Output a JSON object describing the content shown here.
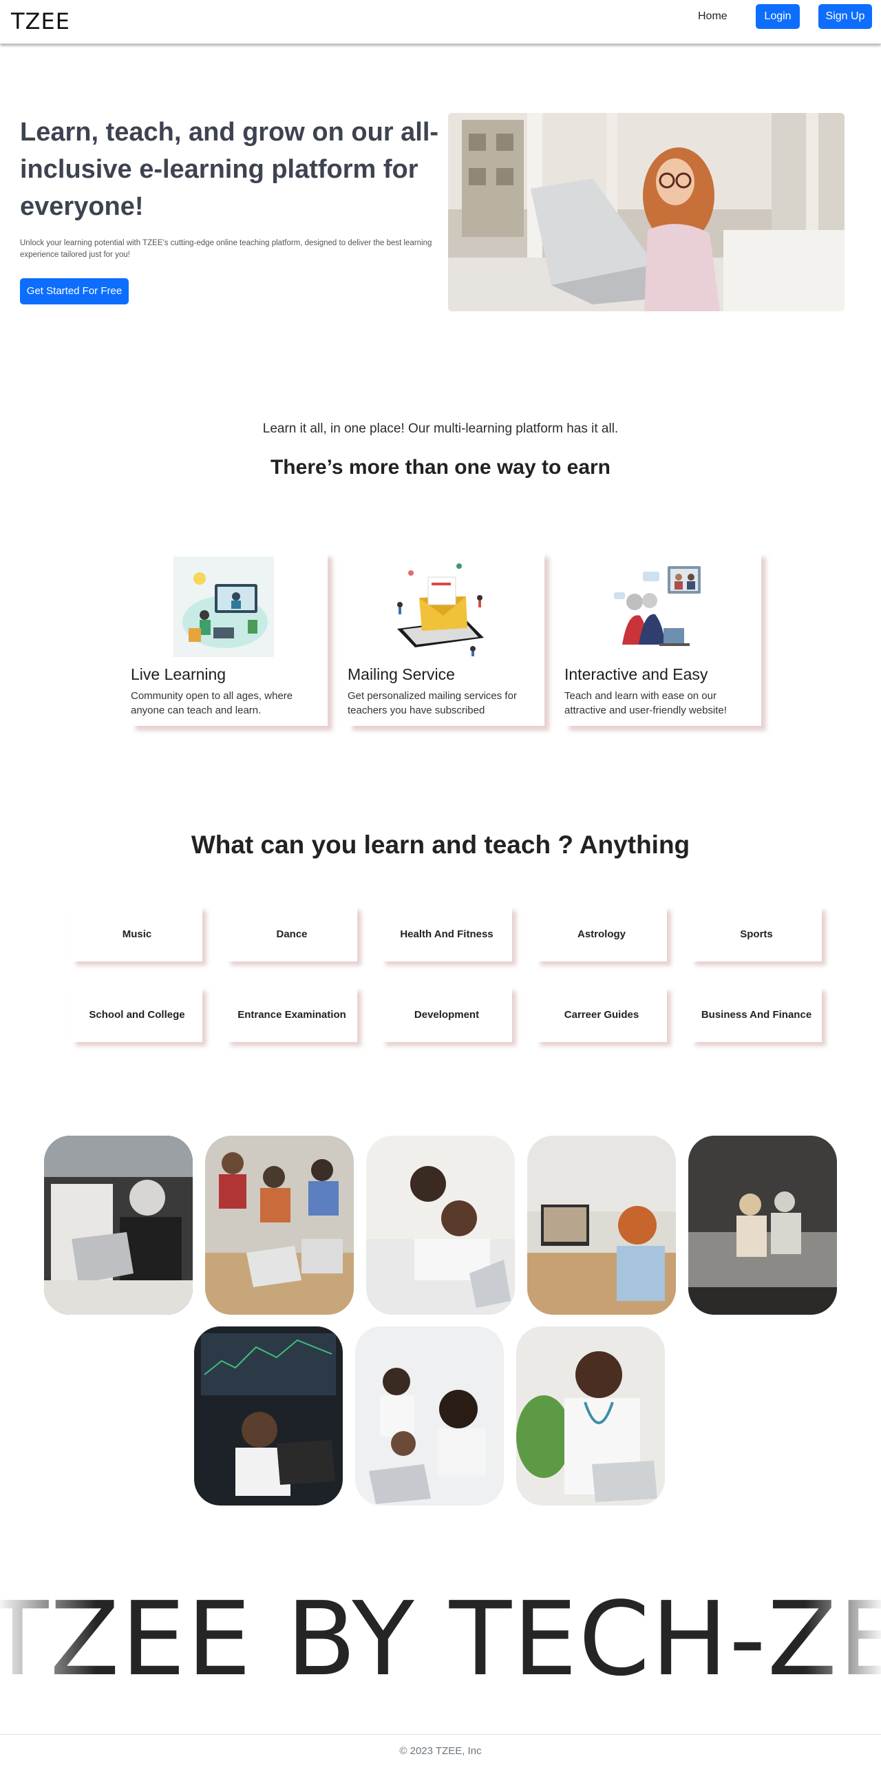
{
  "nav": {
    "brand": "TZEE",
    "home": "Home",
    "login": "Login",
    "signup": "Sign Up"
  },
  "hero": {
    "title": "Learn, teach, and grow on our all-inclusive e-learning platform for everyone!",
    "subtitle": "Unlock your learning potential with TZEE's cutting-edge online teaching platform, designed to deliver the best learning experience tailored just for you!",
    "cta": "Get Started For Free"
  },
  "ways": {
    "kicker": "Learn it all, in one place! Our multi-learning platform has it all.",
    "title": "There’s more than one way to earn",
    "features": [
      {
        "title": "Live Learning",
        "desc": "Community open to all ages, where anyone can teach and learn.",
        "icon": "live-learning-illustration"
      },
      {
        "title": "Mailing Service",
        "desc": "Get personalized mailing services for teachers you have subscribed",
        "icon": "mailing-illustration"
      },
      {
        "title": "Interactive and Easy",
        "desc": "Teach and learn with ease on our attractive and user-friendly website!",
        "icon": "video-call-illustration"
      }
    ]
  },
  "topics": {
    "title": "What can you learn and teach ? Anything",
    "items": [
      "Music",
      "Dance",
      "Health And Fitness",
      "Astrology",
      "Sports",
      "School and College",
      "Entrance Examination",
      "Development",
      "Carreer Guides",
      "Business And Finance"
    ]
  },
  "marquee": {
    "text": "TZEE BY TECH-ZEE"
  },
  "footer": {
    "copyright": "© 2023 TZEE, Inc"
  },
  "colors": {
    "primary": "#0d6efd",
    "heading": "#3d4350",
    "card_shadow": "#c89696"
  }
}
